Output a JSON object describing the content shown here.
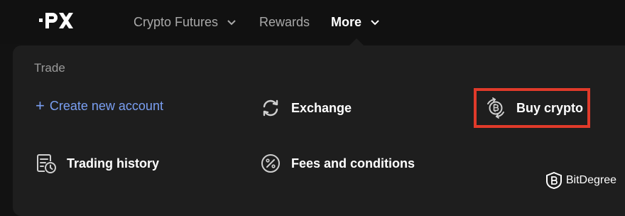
{
  "header": {
    "logo_text": "PX",
    "nav": [
      {
        "label": "Crypto Futures",
        "has_dropdown": true
      },
      {
        "label": "Rewards",
        "has_dropdown": false
      },
      {
        "label": "More",
        "has_dropdown": true,
        "active": true
      }
    ]
  },
  "dropdown": {
    "section_title": "Trade",
    "items": {
      "create_account": "Create new account",
      "exchange": "Exchange",
      "buy_crypto": "Buy crypto",
      "trading_history": "Trading history",
      "fees": "Fees and conditions"
    }
  },
  "highlight_color": "#e03a2a",
  "link_color": "#7a9ff2",
  "watermark": "BitDegree"
}
